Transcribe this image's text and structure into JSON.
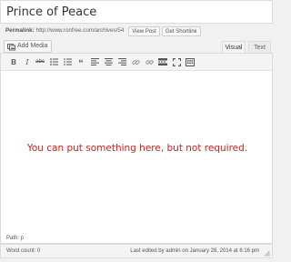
{
  "title": {
    "value": "Prince of Peace"
  },
  "permalink": {
    "label": "Permalink:",
    "url": "http://www.ronfree.com/archives/54",
    "view_post_label": "View Post",
    "get_shortlink_label": "Get Shortlink"
  },
  "media": {
    "add_media_label": "Add Media"
  },
  "tabs": [
    {
      "label": "Visual",
      "active": true
    },
    {
      "label": "Text",
      "active": false
    }
  ],
  "toolbar": {
    "buttons": [
      {
        "label": "B",
        "icon": "bold-icon"
      },
      {
        "label": "I",
        "icon": "italic-icon"
      },
      {
        "label": "abc",
        "icon": "strikethrough-icon"
      },
      {
        "label": "",
        "icon": "bullet-list-icon"
      },
      {
        "label": "",
        "icon": "numbered-list-icon"
      },
      {
        "label": "“",
        "icon": "blockquote-icon"
      },
      {
        "label": "",
        "icon": "align-left-icon"
      },
      {
        "label": "",
        "icon": "align-center-icon"
      },
      {
        "label": "",
        "icon": "align-right-icon"
      },
      {
        "label": "",
        "icon": "insert-link-icon"
      },
      {
        "label": "",
        "icon": "remove-link-icon"
      },
      {
        "label": "",
        "icon": "read-more-icon"
      },
      {
        "label": "",
        "icon": "fullscreen-icon"
      },
      {
        "label": "",
        "icon": "toolbar-toggle-icon"
      }
    ]
  },
  "editor": {
    "content": "You can put something here, but not required.",
    "content_color": "#cc1f1f"
  },
  "path_bar": {
    "text": "Path: p"
  },
  "status": {
    "word_count": "Word count: 0",
    "last_edited": "Last edited by admin on January 28, 2014 at 6:16 pm"
  }
}
